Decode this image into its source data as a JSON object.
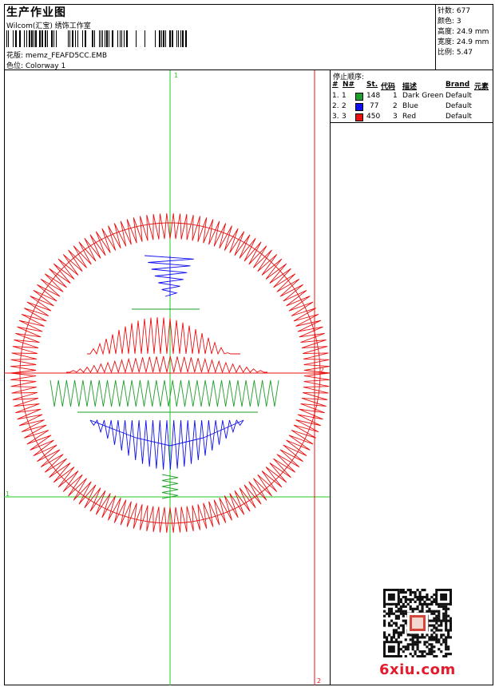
{
  "header": {
    "title": "生产作业图",
    "studio": "Wilcom(汇宝) 绣饰工作室",
    "design_line": "花版:  memz_FEAFD5CC.EMB",
    "colorway_line": "色位:  Colorway 1"
  },
  "stats": [
    {
      "label": "针数:",
      "value": "677"
    },
    {
      "label": "颜色:",
      "value": "3"
    },
    {
      "label": "高度:",
      "value": "24.9 mm"
    },
    {
      "label": "宽度:",
      "value": "24.9 mm"
    },
    {
      "label": "比例:",
      "value": "5.47"
    }
  ],
  "stop_sequence": {
    "title": "停止顺序:",
    "headers": {
      "index": "#",
      "needle": "N#",
      "stitches": "St.",
      "code": "代码",
      "description": "描述",
      "brand": "Brand",
      "element": "元素"
    },
    "rows": [
      {
        "index": "1.",
        "needle": "1",
        "stitches": "148",
        "code": "1",
        "description": "Dark Green",
        "brand": "Default",
        "color": "#1e9e2a"
      },
      {
        "index": "2.",
        "needle": "2",
        "stitches": "77",
        "code": "2",
        "description": "Blue",
        "brand": "Default",
        "color": "#1010ee"
      },
      {
        "index": "3.",
        "needle": "3",
        "stitches": "450",
        "code": "3",
        "description": "Red",
        "brand": "Default",
        "color": "#e81010"
      }
    ]
  },
  "axis_marks": {
    "top": "1",
    "left": "1",
    "right": "2",
    "bottom": "2"
  },
  "colors": {
    "green_guide": "#22cc22",
    "red_guide": "#ee1111",
    "stitch_green": "#1e9e2a",
    "stitch_blue": "#1010ee",
    "stitch_red": "#e81010"
  },
  "watermark": "6xiu.com"
}
